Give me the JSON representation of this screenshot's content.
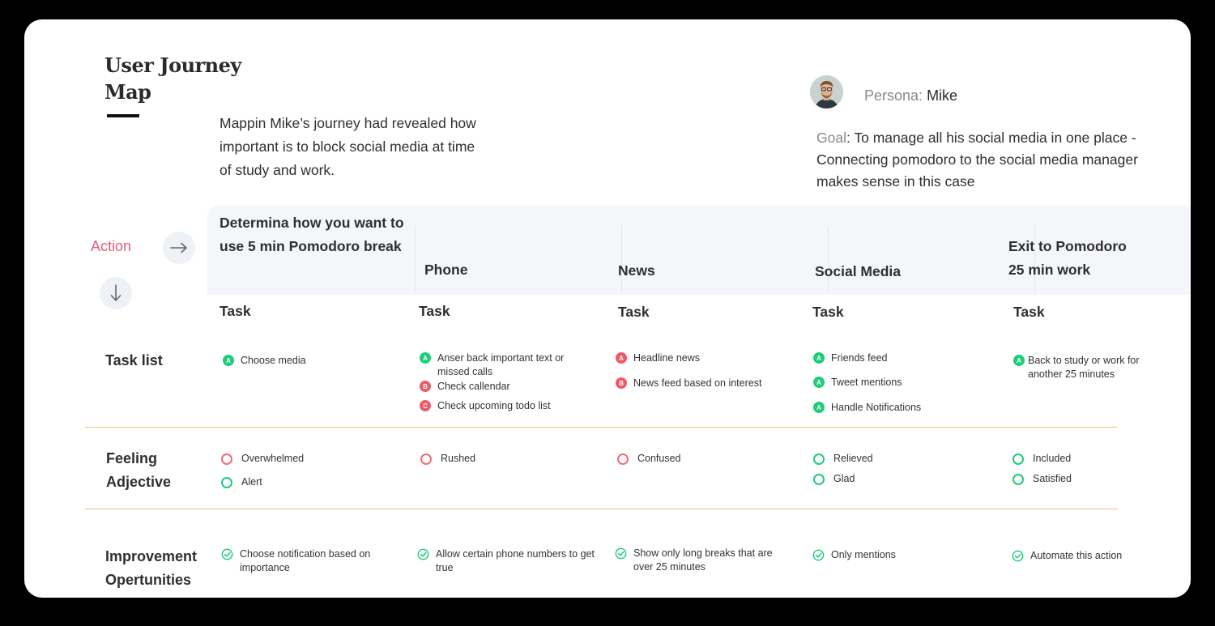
{
  "header": {
    "title_line1": "User Journey",
    "title_line2": "Map",
    "intro": "Mappin Mike’s journey had revealed how important is to block social media at time of study and work."
  },
  "persona": {
    "label": "Persona:",
    "name": "Mike",
    "goal_label": "Goal",
    "goal_text": ": To manage all his social media in one place - Connecting pomodoro to the social media manager makes sense in this case"
  },
  "rows": {
    "action": "Action",
    "task_list": "Task list",
    "feeling_line1": "Feeling",
    "feeling_line2": "Adjective",
    "improvement_line1": "Improvement",
    "improvement_line2": "Opertunities"
  },
  "stages": [
    {
      "action": "Determina how you want to use 5 min Pomodoro break",
      "task_header": "Task",
      "tasks": [
        {
          "badge": "A",
          "text": "Choose media"
        }
      ],
      "feelings": [
        "Overwhelmed",
        "Alert"
      ],
      "improvement": "Choose notification based on importance"
    },
    {
      "action": "Phone",
      "task_header": "Task",
      "tasks": [
        {
          "badge": "A",
          "text": "Anser back important text or missed calls"
        },
        {
          "badge": "B",
          "text": "Check callendar"
        },
        {
          "badge": "C",
          "text": "Check upcoming todo list"
        }
      ],
      "feelings": [
        "Rushed"
      ],
      "improvement": "Allow certain phone numbers to get true"
    },
    {
      "action": "News",
      "task_header": "Task",
      "tasks": [
        {
          "badge": "A",
          "text": "Headline news"
        },
        {
          "badge": "B",
          "text": "News feed based on interest"
        }
      ],
      "feelings": [
        "Confused"
      ],
      "improvement": "Show only long breaks that are over 25 minutes"
    },
    {
      "action": "Social Media",
      "task_header": "Task",
      "tasks": [
        {
          "badge": "A",
          "text": "Friends feed"
        },
        {
          "badge": "A",
          "text": "Tweet mentions"
        },
        {
          "badge": "A",
          "text": "Handle Notifications"
        }
      ],
      "feelings": [
        "Relieved",
        "Glad"
      ],
      "improvement": "Only mentions"
    },
    {
      "action": "Exit to Pomodoro 25 min work",
      "task_header": "Task",
      "tasks": [
        {
          "badge": "A",
          "text": "Back to study or work for another 25 minutes"
        }
      ],
      "feelings": [
        "Included",
        "Satisfied"
      ],
      "improvement": "Automate this action"
    }
  ],
  "colors": {
    "accent_pink": "#e85b7f",
    "positive_green": "#1fcc7a",
    "negative_red": "#ef5a67",
    "divider_orange": "#f0c27a"
  },
  "icons": {
    "action_arrow": "arrow-right-icon",
    "scroll_down": "arrow-down-icon",
    "improvement": "check-circle-icon"
  }
}
